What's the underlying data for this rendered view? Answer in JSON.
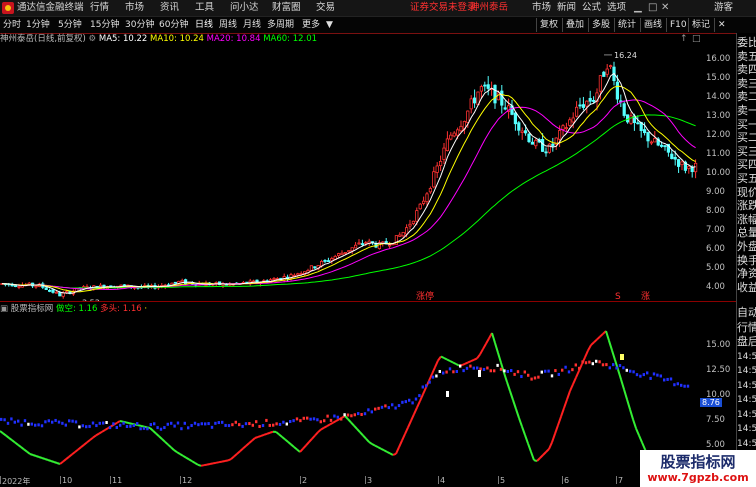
{
  "app": {
    "title": "通达信金融终端",
    "menu": [
      "行情",
      "市场",
      "资讯",
      "工具",
      "问小达",
      "财富圈",
      "交易"
    ],
    "notice": "证券交易未登录",
    "stock_tag": "神州泰岳",
    "right_menu": [
      "市场",
      "新闻",
      "公式",
      "选项"
    ],
    "guest": "游客"
  },
  "toolbar": {
    "periods": [
      "分时",
      "1分钟",
      "5分钟",
      "15分钟",
      "30分钟",
      "60分钟",
      "日线",
      "周线",
      "月线",
      "多周期",
      "更多"
    ],
    "active": "日线",
    "buttons": [
      "复权",
      "叠加",
      "多股",
      "统计",
      "画线",
      "F10",
      "标记"
    ]
  },
  "main_info": {
    "name": "神州泰岳(日线,前复权)",
    "ma5": "MA5: 10.22",
    "ma10": "MA10: 10.24",
    "ma20": "MA20: 10.84",
    "ma60": "MA60: 12.01",
    "colors": {
      "ma5": "#ffffff",
      "ma10": "#ffff00",
      "ma20": "#ff00ff",
      "ma60": "#00ff00"
    }
  },
  "sub_info": {
    "name": "股票指标网",
    "duokong_label": "做空:",
    "duokong_val": "1.16",
    "duotou_label": "多头:",
    "duotou_val": "1.16",
    "kongtou_label": "空头:",
    "kongtou_val": "·"
  },
  "right_panel": {
    "items": [
      "委比",
      "卖五",
      "卖四",
      "卖三",
      "卖二",
      "卖一",
      "买一",
      "买二",
      "买三",
      "买四",
      "买五",
      "现价",
      "涨跌",
      "涨幅",
      "总量",
      "外盘",
      "换手",
      "净资",
      "收益"
    ],
    "items2": [
      "自动",
      "行情",
      "盘后",
      "14:50",
      "14:50",
      "14:50",
      "14:50",
      "14:50",
      "14:50",
      "14:50",
      "14:5"
    ]
  },
  "axis_main": [
    "16.00",
    "15.00",
    "14.00",
    "13.00",
    "12.00",
    "11.00",
    "10.00",
    "9.00",
    "8.00",
    "7.00",
    "6.00",
    "5.00",
    "4.00"
  ],
  "axis_sub": [
    "15.00",
    "12.50",
    "10.00",
    "7.50",
    "5.00"
  ],
  "sub_current": "8.76",
  "x_labels": [
    "2022年",
    "10",
    "11",
    "12",
    "2",
    "3",
    "4",
    "5",
    "6",
    "7"
  ],
  "annotations": {
    "high": "16.24",
    "low": "3.53",
    "tag1": "涨停",
    "tag2": "S",
    "tag3": "涨"
  },
  "watermark": {
    "line1": "股票指标网",
    "line2": "www.7gpzb.com"
  },
  "chart_data": {
    "type": "candlestick",
    "main_price_range": [
      3.5,
      16.5
    ],
    "sub_range": [
      2.5,
      17.5
    ],
    "grid": false
  }
}
